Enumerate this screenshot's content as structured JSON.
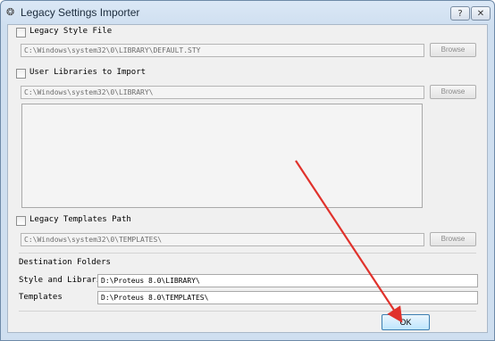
{
  "window": {
    "title": "Legacy Settings Importer",
    "help_label": "?",
    "close_label": "✕"
  },
  "style_file": {
    "label": "Legacy Style File",
    "path": "C:\\Windows\\system32\\0\\LIBRARY\\DEFAULT.STY",
    "browse": "Browse"
  },
  "user_libraries": {
    "label": "User Libraries to Import",
    "path": "C:\\Windows\\system32\\0\\LIBRARY\\",
    "browse": "Browse",
    "items": []
  },
  "templates_path": {
    "label": "Legacy Templates Path",
    "path": "C:\\Windows\\system32\\0\\TEMPLATES\\",
    "browse": "Browse"
  },
  "destination": {
    "heading": "Destination Folders",
    "style_label": "Style and Libraries",
    "style_value": "D:\\Proteus 8.0\\LIBRARY\\",
    "templates_label": "Templates",
    "templates_value": "D:\\Proteus 8.0\\TEMPLATES\\"
  },
  "footer": {
    "ok_label": "OK"
  },
  "colors": {
    "annotation_arrow": "#e0322c",
    "title_bar": "#cfdff0"
  }
}
